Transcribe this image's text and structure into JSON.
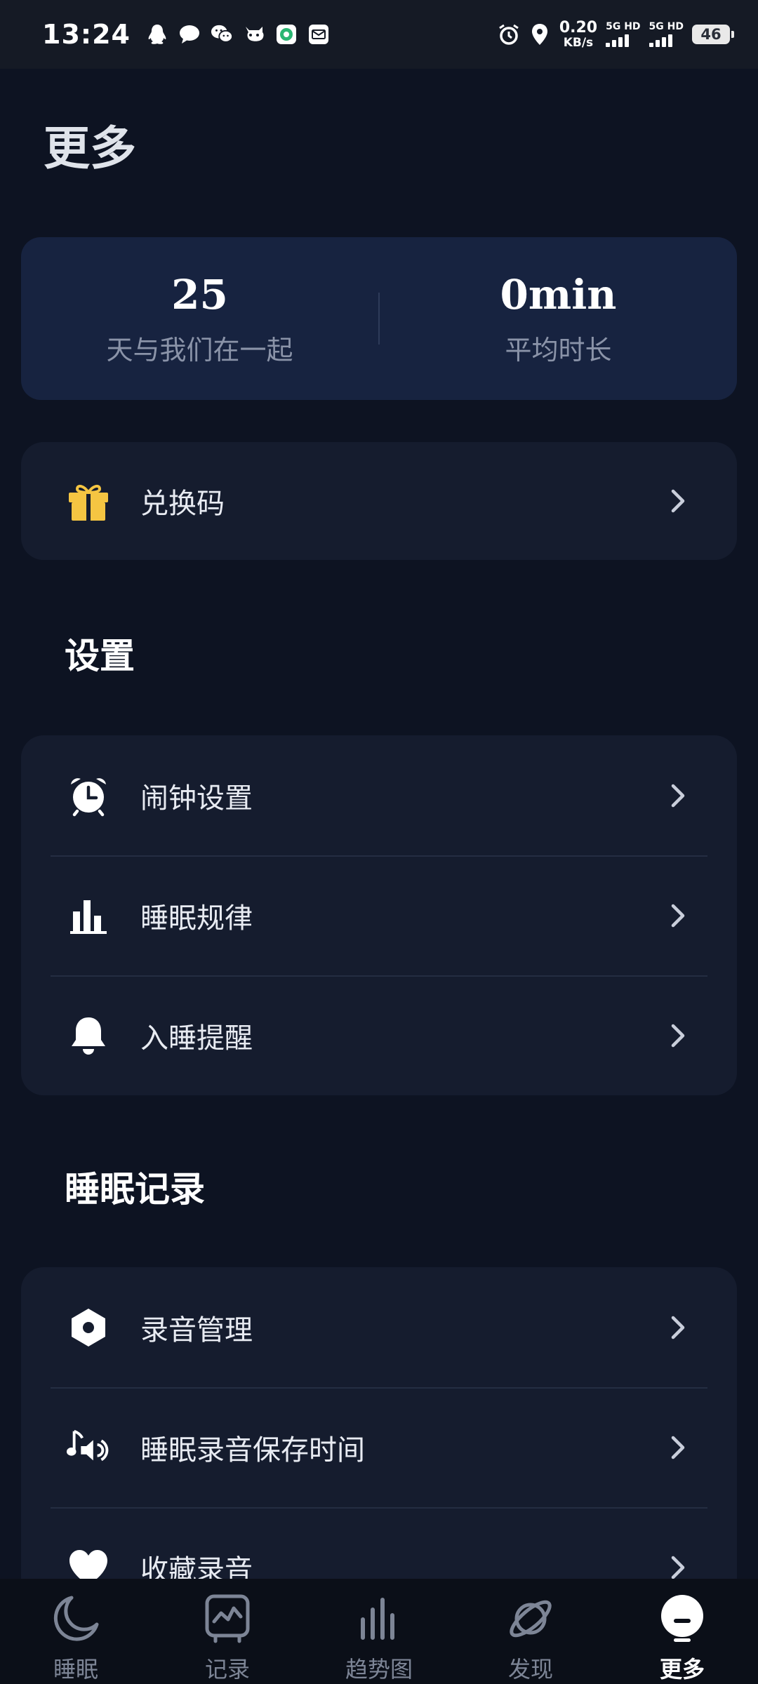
{
  "status_bar": {
    "time": "13:24",
    "net_speed_value": "0.20",
    "net_speed_unit": "KB/s",
    "sim1_label": "5G HD",
    "sim2_label": "5G HD",
    "battery": "46",
    "left_icons": [
      "qq-icon",
      "message-icon",
      "wechat-icon",
      "app-icon",
      "app-green-icon",
      "mail-icon"
    ],
    "right_icons": [
      "alarm-icon",
      "location-icon"
    ]
  },
  "page": {
    "title": "更多"
  },
  "stats": {
    "days_value": "25",
    "days_label": "天与我们在一起",
    "avg_value": "0min",
    "avg_label": "平均时长"
  },
  "redeem": {
    "label": "兑换码",
    "icon": "gift-icon",
    "icon_color": "#f5c542"
  },
  "settings": {
    "title": "设置",
    "items": [
      {
        "label": "闹钟设置",
        "icon": "alarm-clock-icon"
      },
      {
        "label": "睡眠规律",
        "icon": "bar-chart-icon"
      },
      {
        "label": "入睡提醒",
        "icon": "bell-icon"
      }
    ]
  },
  "sleep_records": {
    "title": "睡眠记录",
    "items": [
      {
        "label": "录音管理",
        "icon": "hexagon-nut-icon"
      },
      {
        "label": "睡眠录音保存时间",
        "icon": "music-volume-icon"
      },
      {
        "label": "收藏录音",
        "icon": "heart-icon"
      }
    ]
  },
  "bottom_nav": {
    "items": [
      {
        "label": "睡眠",
        "icon": "moon-icon",
        "active": false
      },
      {
        "label": "记录",
        "icon": "record-chart-icon",
        "active": false
      },
      {
        "label": "趋势图",
        "icon": "trend-bars-icon",
        "active": false
      },
      {
        "label": "发现",
        "icon": "planet-icon",
        "active": false
      },
      {
        "label": "更多",
        "icon": "more-face-icon",
        "active": true
      }
    ]
  },
  "colors": {
    "background": "#0d1322",
    "stats_card": "#172340",
    "card": "#151c2e",
    "gift": "#f5c542",
    "muted_text": "#8a93a8"
  }
}
